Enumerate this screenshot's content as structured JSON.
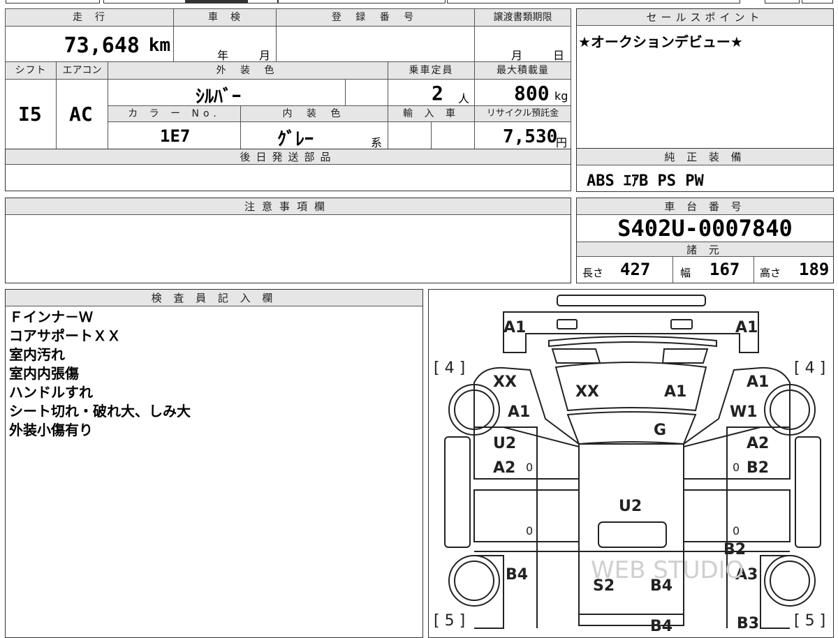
{
  "top_fields": {
    "odometer": {
      "header": "走　行",
      "value": "73,648",
      "unit": "km"
    },
    "inspection": {
      "header": "車　検",
      "year_label": "年",
      "month_label": "月"
    },
    "registration": {
      "header": "登 録 番 号",
      "value": ""
    },
    "transfer_deadline": {
      "header": "譲渡書類期限",
      "month_label": "月",
      "day_label": "日"
    },
    "shift": {
      "header": "シフト",
      "value": "I5"
    },
    "aircon": {
      "header": "エアコン",
      "value": "AC"
    },
    "exterior_color": {
      "header": "外 装 色",
      "value": "ｼﾙﾊﾞｰ"
    },
    "capacity": {
      "header": "乗車定員",
      "value": "2",
      "unit": "人"
    },
    "max_load": {
      "header": "最大積載量",
      "value": "800",
      "unit": "kg"
    },
    "color_no": {
      "header": "カ ラ ー No.",
      "value": "1E7"
    },
    "interior_color": {
      "header": "内 装 色",
      "value": "ｸﾞﾚｰ",
      "suffix": "系"
    },
    "import": {
      "header": "輸 入 車",
      "value": ""
    },
    "recycle_fee": {
      "header": "リサイクル預託金",
      "value": "7,530",
      "unit": "円"
    }
  },
  "sales_point": {
    "header": "セールスポイント",
    "text": "★オークションデビュー★"
  },
  "later_parts": {
    "header": "後日発送部品",
    "text": ""
  },
  "genuine_equipment": {
    "header": "純 正 装 備",
    "text": "ABS ｴｱB PS PW"
  },
  "caution": {
    "header": "注意事項欄",
    "text": ""
  },
  "chassis_number": {
    "header": "車 台 番 号",
    "value": "S402U-0007840"
  },
  "specs": {
    "header": "諸 元",
    "length": {
      "label": "長さ",
      "value": "427"
    },
    "width": {
      "label": "幅",
      "value": "167"
    },
    "height": {
      "label": "高さ",
      "value": "189"
    }
  },
  "inspector": {
    "header": "検 査 員 記 入 欄",
    "notes": [
      "Ｆインナ－Ｗ",
      "コアサポートＸＸ",
      "室内汚れ",
      "室内内張傷",
      "ハンドルすれ",
      "シート切れ・破れ大、しみ大",
      "外装小傷有り"
    ]
  },
  "diagram": {
    "watermark": "WEB STUDIO",
    "tire_labels": {
      "front_left": "[ 4 ]",
      "front_right": "[ 4 ]",
      "rear_left": "[ 5 ]",
      "rear_right": "[ 5 ]"
    },
    "marks": {
      "front_bumper_left": "A1",
      "front_bumper_right": "A1",
      "left_fender_top": "XX",
      "left_fender": "A1",
      "hood_left": "XX",
      "hood_right": "A1",
      "right_fender_top": "A1",
      "right_fender": "W1",
      "windshield": "G",
      "left_front_door_1": "U2",
      "left_front_door_2": "A2",
      "right_front_door_1": "A2",
      "right_front_door_2": "B2",
      "roof": "U2",
      "right_rear_door": "B2",
      "left_rear_quarter": "B4",
      "rear_left": "S2",
      "rear_center": "B4",
      "right_rear_quarter": "A3",
      "rear_bottom_center": "B4",
      "rear_bottom_right": "B3",
      "zero_marks": [
        "0",
        "0",
        "0",
        "0"
      ]
    }
  }
}
